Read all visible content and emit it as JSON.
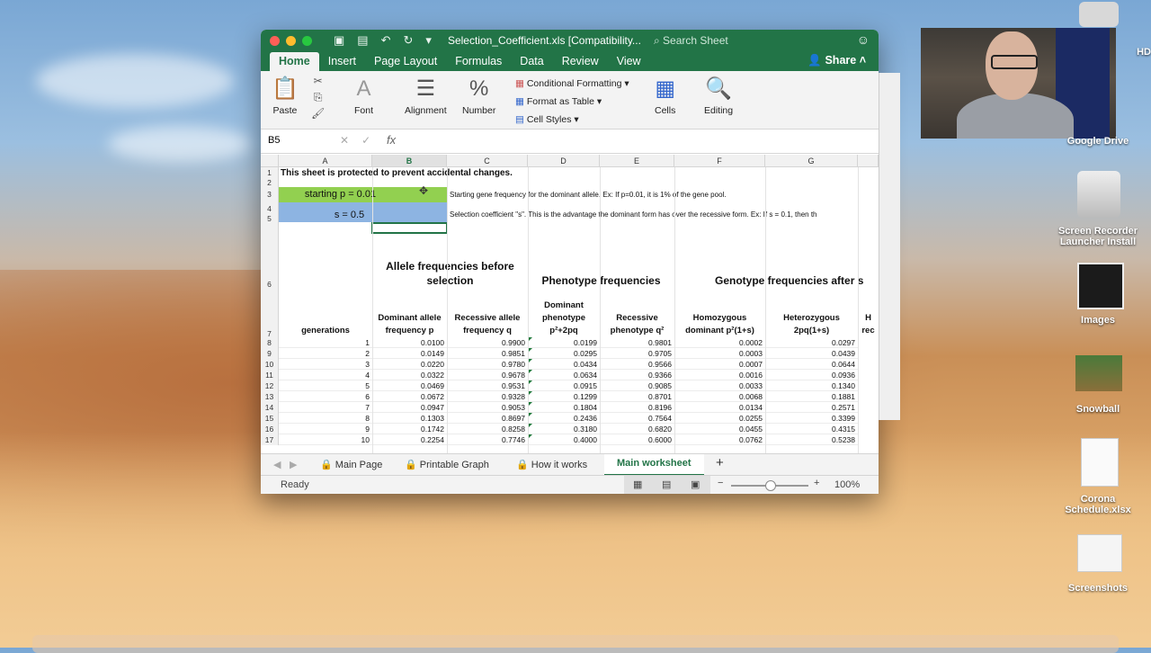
{
  "window": {
    "title": "Selection_Coefficient.xls  [Compatibility...",
    "search_placeholder": "Search Sheet",
    "tabs": [
      "Home",
      "Insert",
      "Page Layout",
      "Formulas",
      "Data",
      "Review",
      "View"
    ],
    "share": "Share",
    "ribbon": {
      "paste": "Paste",
      "font": "Font",
      "alignment": "Alignment",
      "number": "Number",
      "conditional": "Conditional Formatting",
      "format_table": "Format as Table",
      "cell_styles": "Cell Styles",
      "cells": "Cells",
      "editing": "Editing"
    },
    "name_box": "B5",
    "fx": "fx"
  },
  "sheet": {
    "columns": [
      "A",
      "B",
      "C",
      "D",
      "E",
      "F",
      "G"
    ],
    "protected_note": "This sheet is protected to prevent accidental changes.",
    "starting_p": "starting p = 0.01",
    "s_value": "s = 0.5",
    "note_p": "Starting gene frequency for the dominant allele. Ex: If p=0.01, it is 1% of the gene pool.",
    "note_s": "Selection coefficient \"s\". This is the advantage the dominant form has over the recessive form. Ex: If s = 0.1, then th",
    "section_allele": "Allele frequencies before selection",
    "section_pheno": "Phenotype frequencies",
    "section_geno": "Genotype frequencies after s",
    "headers": [
      "generations",
      "Dominant allele frequency p",
      "Recessive allele frequency q",
      "Dominant phenotype p²+2pq",
      "Recessive phenotype q²",
      "Homozygous dominant p²(1+s)",
      "Heterozygous 2pq(1+s)",
      "H rec"
    ],
    "rows": [
      [
        "1",
        "0.0100",
        "0.9900",
        "0.0199",
        "0.9801",
        "0.0002",
        "0.0297"
      ],
      [
        "2",
        "0.0149",
        "0.9851",
        "0.0295",
        "0.9705",
        "0.0003",
        "0.0439"
      ],
      [
        "3",
        "0.0220",
        "0.9780",
        "0.0434",
        "0.9566",
        "0.0007",
        "0.0644"
      ],
      [
        "4",
        "0.0322",
        "0.9678",
        "0.0634",
        "0.9366",
        "0.0016",
        "0.0936"
      ],
      [
        "5",
        "0.0469",
        "0.9531",
        "0.0915",
        "0.9085",
        "0.0033",
        "0.1340"
      ],
      [
        "6",
        "0.0672",
        "0.9328",
        "0.1299",
        "0.8701",
        "0.0068",
        "0.1881"
      ],
      [
        "7",
        "0.0947",
        "0.9053",
        "0.1804",
        "0.8196",
        "0.0134",
        "0.2571"
      ],
      [
        "8",
        "0.1303",
        "0.8697",
        "0.2436",
        "0.7564",
        "0.0255",
        "0.3399"
      ],
      [
        "9",
        "0.1742",
        "0.8258",
        "0.3180",
        "0.6820",
        "0.0455",
        "0.4315"
      ],
      [
        "10",
        "0.2254",
        "0.7746",
        "0.4000",
        "0.6000",
        "0.0762",
        "0.5238"
      ]
    ],
    "row_numbers": [
      "1",
      "2",
      "3",
      "4",
      "5",
      "6",
      "7",
      "8",
      "9",
      "10",
      "11",
      "12",
      "13",
      "14",
      "15",
      "16",
      "17"
    ]
  },
  "sheet_tabs": [
    "Main Page",
    "Printable Graph",
    "How it works",
    "Main worksheet"
  ],
  "status": {
    "ready": "Ready",
    "zoom": "100%"
  },
  "desktop": {
    "hd": "HD",
    "google_drive": "Google Drive",
    "screen_recorder": "Screen Recorder Launcher Install",
    "images": "Images",
    "snowball": "Snowball",
    "corona": "Corona Schedule.xlsx",
    "screenshots": "Screenshots"
  },
  "colors": {
    "excel_green": "#227447",
    "lime": "#92d050",
    "sky": "#8db4e2"
  }
}
